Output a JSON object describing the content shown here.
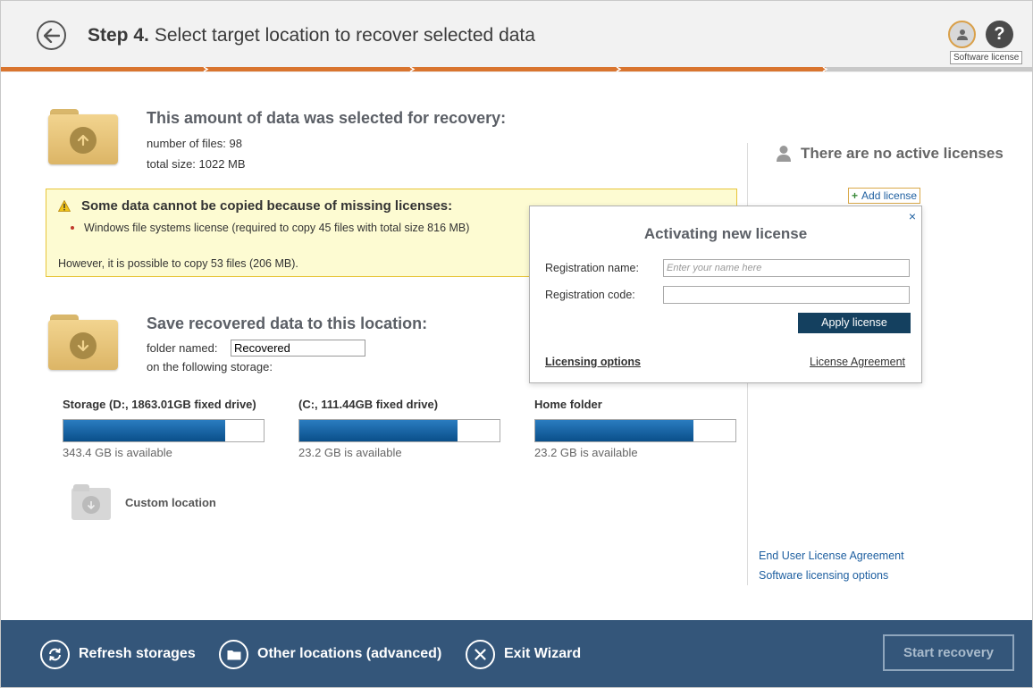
{
  "header": {
    "step_label": "Step 4.",
    "title": "Select target location to recover selected data",
    "tooltip": "Software license",
    "help_glyph": "?",
    "progress_completed_fraction": 0.8
  },
  "selection": {
    "heading": "This amount of data was selected for recovery:",
    "files": "number of files: 98",
    "size": "total size: 1022 MB"
  },
  "warning": {
    "title": "Some data cannot be copied because of missing licenses:",
    "item": "Windows file systems license (required to copy 45 files with total size 816 MB)",
    "note": "However, it is possible to copy 53 files (206 MB)."
  },
  "save": {
    "heading": "Save recovered data to this location:",
    "folder_label": "folder named:",
    "folder_value": "Recovered",
    "storage_label": "on the following storage:"
  },
  "storages": [
    {
      "name": "Storage (D:, 1863.01GB fixed drive)",
      "available": "343.4 GB is available",
      "used_fraction": 0.81
    },
    {
      "name": "(C:, 111.44GB fixed drive)",
      "available": "23.2 GB is available",
      "used_fraction": 0.79
    },
    {
      "name": "Home folder",
      "available": "23.2 GB is available",
      "used_fraction": 0.79
    }
  ],
  "custom_location": "Custom location",
  "licenses": {
    "status": "There are no active licenses",
    "add": "Add license",
    "eula": "End User License Agreement",
    "options": "Software licensing options"
  },
  "popup": {
    "close": "×",
    "title": "Activating new license",
    "name_label": "Registration name:",
    "name_placeholder": "Enter your name here",
    "code_label": "Registration code:",
    "apply": "Apply license",
    "licensing_options": "Licensing options",
    "agreement": "License Agreement"
  },
  "footer": {
    "refresh": "Refresh storages",
    "other": "Other locations (advanced)",
    "exit": "Exit Wizard",
    "start": "Start recovery"
  },
  "colors": {
    "accent": "#d9752f",
    "footer_bg": "#34567a",
    "apply_bg": "#14405f",
    "link": "#1e5fa0"
  }
}
